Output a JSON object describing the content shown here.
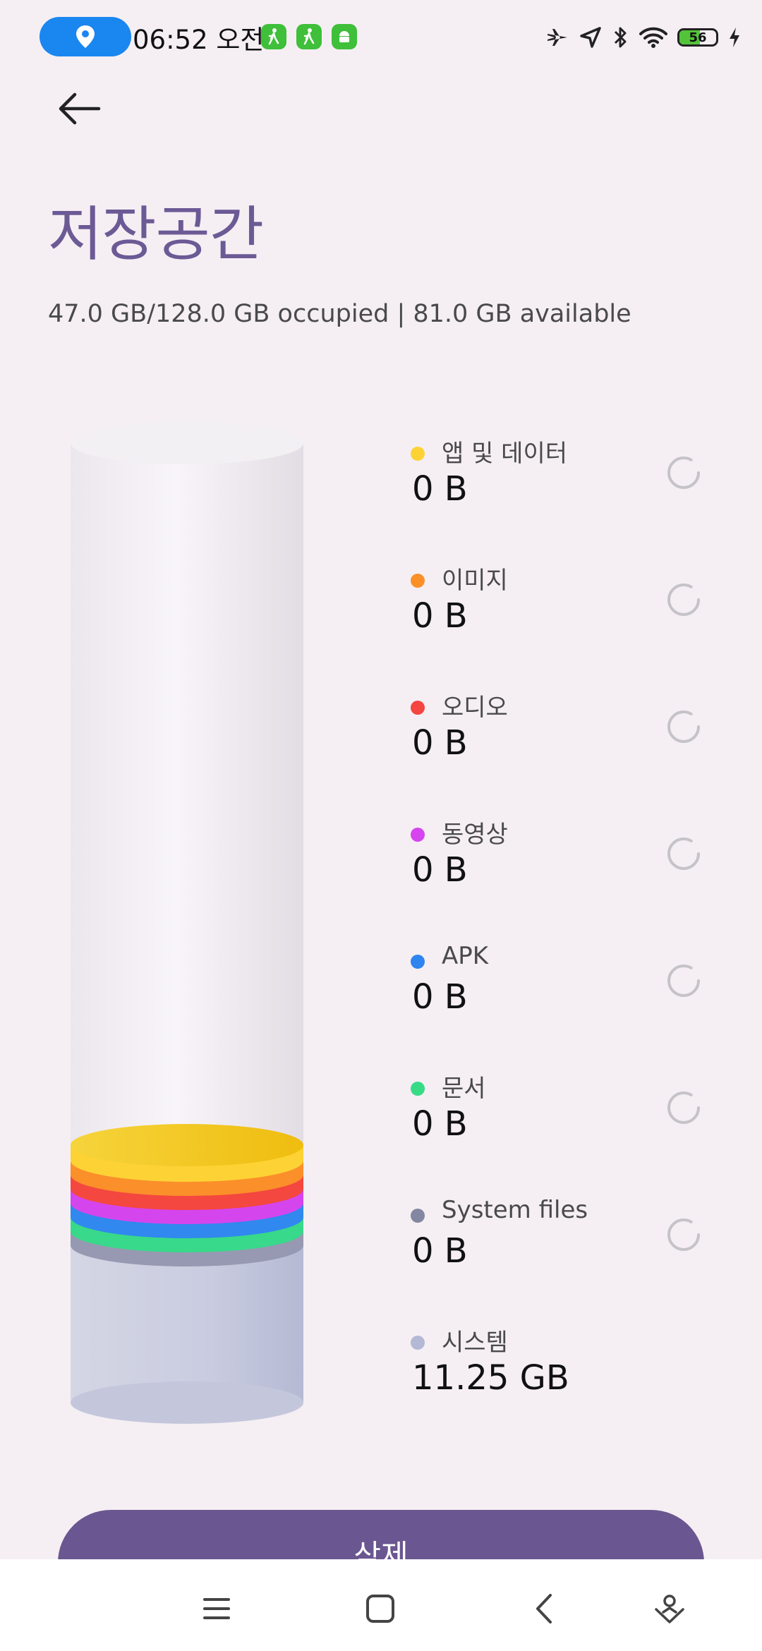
{
  "status_bar": {
    "time": "06:52 오전",
    "battery_level": "56",
    "icons": [
      "location-icon",
      "walk-icon",
      "walk-icon",
      "android-icon",
      "airplane-icon",
      "navigation-icon",
      "bluetooth-icon",
      "wifi-icon",
      "battery-icon",
      "charging-icon"
    ]
  },
  "header": {
    "title": "저장공간",
    "summary": "47.0 GB/128.0 GB occupied | 81.0 GB available"
  },
  "categories": [
    {
      "label": "앱 및 데이터",
      "size": "0 B",
      "color": "#fdd235",
      "loading": true
    },
    {
      "label": "이미지",
      "size": "0 B",
      "color": "#fb9029",
      "loading": true
    },
    {
      "label": "오디오",
      "size": "0 B",
      "color": "#f44541",
      "loading": true
    },
    {
      "label": "동영상",
      "size": "0 B",
      "color": "#d743ef",
      "loading": true
    },
    {
      "label": "APK",
      "size": "0 B",
      "color": "#2f85ee",
      "loading": true
    },
    {
      "label": "문서",
      "size": "0 B",
      "color": "#37db86",
      "loading": true
    },
    {
      "label": "System files",
      "size": "0 B",
      "color": "#8487a2",
      "loading": true
    },
    {
      "label": "시스템",
      "size": "11.25 GB",
      "color": "#b3b8d4",
      "loading": false
    }
  ],
  "actions": {
    "delete_label": "삭제"
  }
}
